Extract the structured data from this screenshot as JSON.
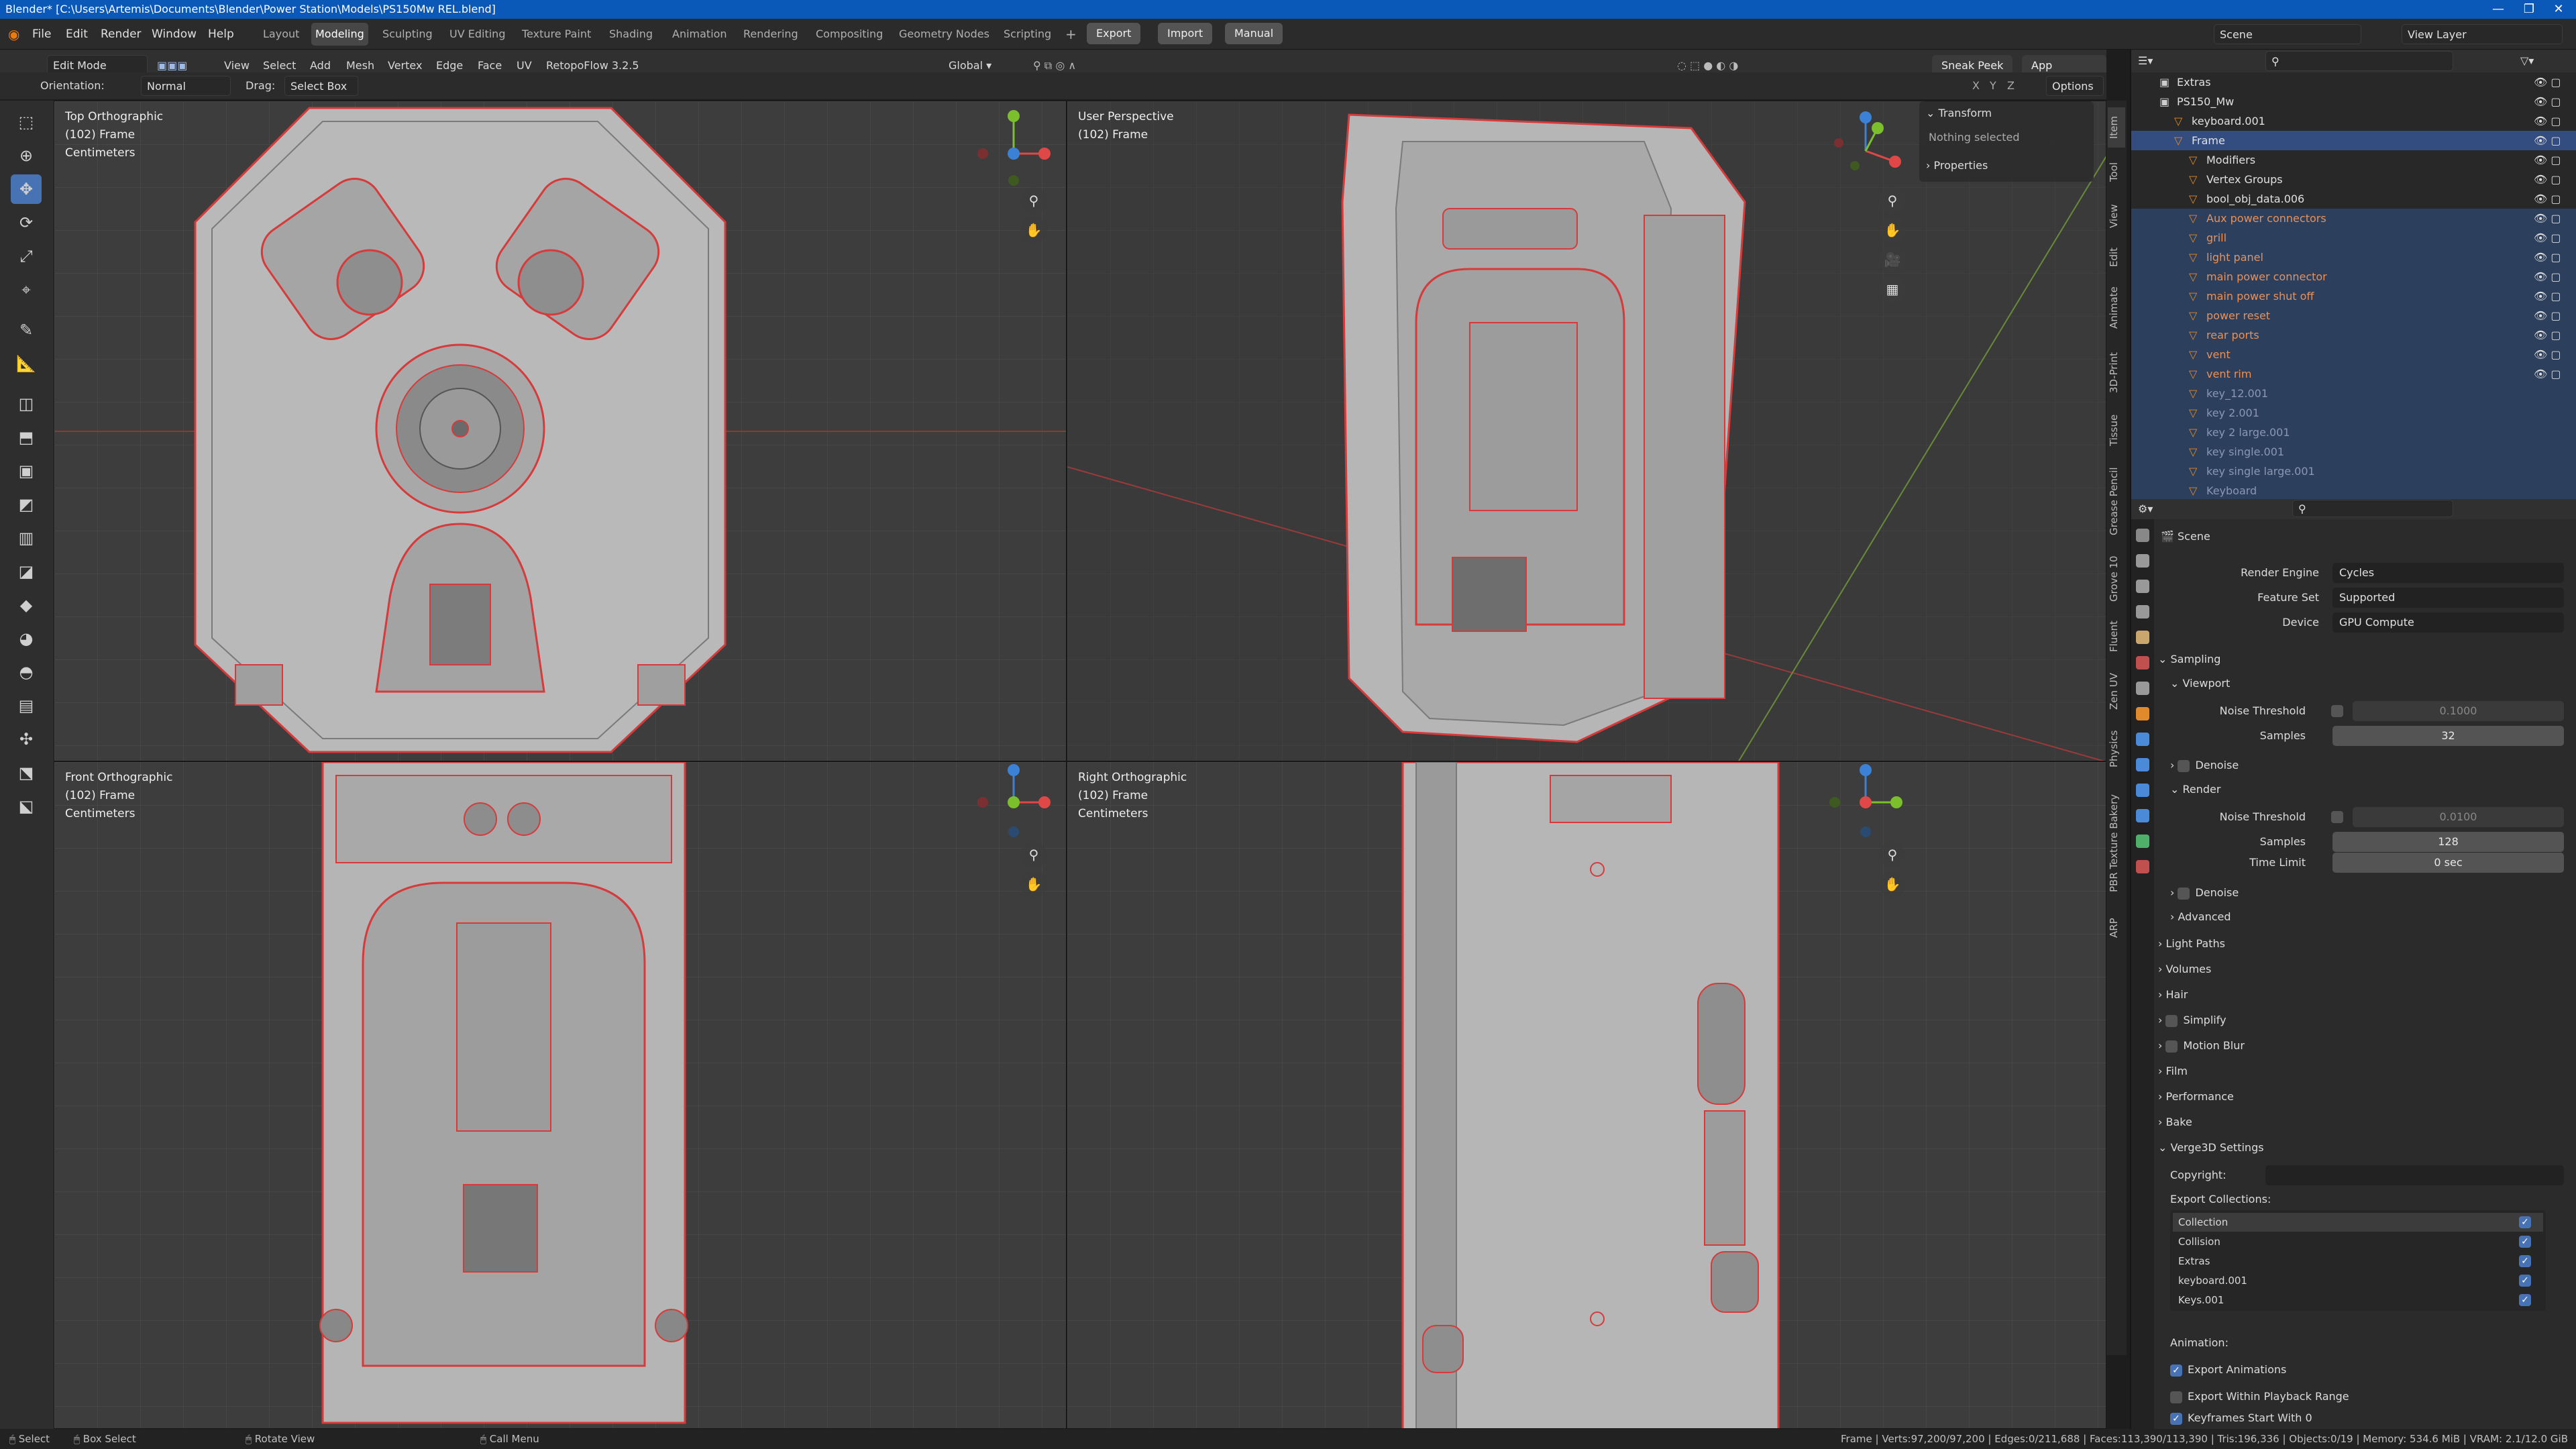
{
  "window": {
    "title": "Blender* [C:\\Users\\Artemis\\Documents\\Blender\\Power Station\\Models\\PS150Mw REL.blend]",
    "controls": [
      "—",
      "❐",
      "✕"
    ]
  },
  "menu": {
    "items": [
      "File",
      "Edit",
      "Render",
      "Window",
      "Help"
    ],
    "workspaces": [
      "Layout",
      "Modeling",
      "Sculpting",
      "UV Editing",
      "Texture Paint",
      "Shading",
      "Animation",
      "Rendering",
      "Compositing",
      "Geometry Nodes",
      "Scripting"
    ],
    "active_workspace": "Modeling",
    "plus": "+",
    "export_label": "Export",
    "import_label": "Import",
    "manual_label": "Manual",
    "scene_label": "Scene",
    "view_layer_label": "View Layer"
  },
  "header": {
    "mode": "Edit Mode",
    "menus": [
      "View",
      "Select",
      "Add",
      "Mesh",
      "Vertex",
      "Edge",
      "Face",
      "UV"
    ],
    "addon": "RetopoFlow 3.2.5",
    "transform_orientation": "Global",
    "sneak_peek": "Sneak Peek",
    "app_manager": "App Manager",
    "options": "Options",
    "axes": [
      "X",
      "Y",
      "Z"
    ]
  },
  "subheader": {
    "orientation_label": "Orientation:",
    "orientation_value": "Normal",
    "drag_label": "Drag:",
    "drag_value": "Select Box"
  },
  "viewports": {
    "top": {
      "title": "Top Orthographic",
      "frame": "(102) Frame",
      "units": "Centimeters"
    },
    "persp": {
      "title": "User Perspective",
      "frame": "(102) Frame"
    },
    "front": {
      "title": "Front Orthographic",
      "frame": "(102) Frame",
      "units": "Centimeters"
    },
    "right": {
      "title": "Right Orthographic",
      "frame": "(102) Frame",
      "units": "Centimeters"
    }
  },
  "npanel": {
    "transform": "Transform",
    "nothing": "Nothing selected",
    "properties": "Properties",
    "tabs": [
      "Item",
      "Tool",
      "View",
      "Edit",
      "Animate",
      "3D-Print",
      "Tissue",
      "Grease Pencil",
      "Grove 10",
      "Fluent",
      "Zen UV",
      "Physics",
      "PBR Texture Bakery",
      "ARP"
    ]
  },
  "outliner": {
    "rows": [
      {
        "label": "Extras",
        "depth": 1
      },
      {
        "label": "PS150_Mw",
        "depth": 1
      },
      {
        "label": "keyboard.001",
        "depth": 2
      },
      {
        "label": "Frame",
        "depth": 2
      },
      {
        "label": "Modifiers",
        "depth": 3
      },
      {
        "label": "Vertex Groups",
        "depth": 3
      },
      {
        "label": "bool_obj_data.006",
        "depth": 3
      },
      {
        "label": "Aux power connectors",
        "depth": 3
      },
      {
        "label": "grill",
        "depth": 3
      },
      {
        "label": "light panel",
        "depth": 3
      },
      {
        "label": "main power connector",
        "depth": 3
      },
      {
        "label": "main power shut off",
        "depth": 3
      },
      {
        "label": "power reset",
        "depth": 3
      },
      {
        "label": "rear ports",
        "depth": 3
      },
      {
        "label": "vent",
        "depth": 3
      },
      {
        "label": "vent rim",
        "depth": 3
      },
      {
        "label": "key_12.001",
        "depth": 3
      },
      {
        "label": "key 2.001",
        "depth": 3
      },
      {
        "label": "key 2 large.001",
        "depth": 3
      },
      {
        "label": "key single.001",
        "depth": 3
      },
      {
        "label": "key single large.001",
        "depth": 3
      },
      {
        "label": "Keyboard",
        "depth": 3
      }
    ]
  },
  "properties": {
    "context": "Scene",
    "render_engine_label": "Render Engine",
    "render_engine": "Cycles",
    "feature_set_label": "Feature Set",
    "feature_set": "Supported",
    "device_label": "Device",
    "device": "GPU Compute",
    "sampling": "Sampling",
    "viewport": "Viewport",
    "noise_threshold_label": "Noise Threshold",
    "viewport_noise": "0.1000",
    "samples_label": "Samples",
    "viewport_samples": "32",
    "denoise": "Denoise",
    "render": "Render",
    "render_noise": "0.0100",
    "render_samples": "128",
    "time_limit_label": "Time Limit",
    "time_limit": "0 sec",
    "advanced": "Advanced",
    "sections": [
      "Light Paths",
      "Volumes",
      "Hair",
      "Simplify",
      "Motion Blur",
      "Film",
      "Performance",
      "Bake"
    ],
    "verge": "Verge3D Settings",
    "copyright_label": "Copyright:",
    "export_collections_label": "Export Collections:",
    "collections": [
      "Collection",
      "Collision",
      "Extras",
      "keyboard.001",
      "Keys.001"
    ],
    "animation_label": "Animation:",
    "export_animations": "Export Animations",
    "export_within_range": "Export Within Playback Range",
    "keyframes_start": "Keyframes Start With 0"
  },
  "status": {
    "select": "Select",
    "box_select": "Box Select",
    "rotate": "Rotate View",
    "call_menu": "Call Menu",
    "stats": "Frame | Verts:97,200/97,200 | Edges:0/211,688 | Faces:113,390/113,390 | Tris:196,336 | Objects:0/19 | Memory: 534.6 MiB | VRAM: 2.1/12.0 GiB"
  },
  "colors": {
    "accent": "#4772b3",
    "wire": "#d63a3a",
    "axis_x": "#e04848",
    "axis_y": "#7bbf2c",
    "axis_z": "#3b82d6"
  }
}
